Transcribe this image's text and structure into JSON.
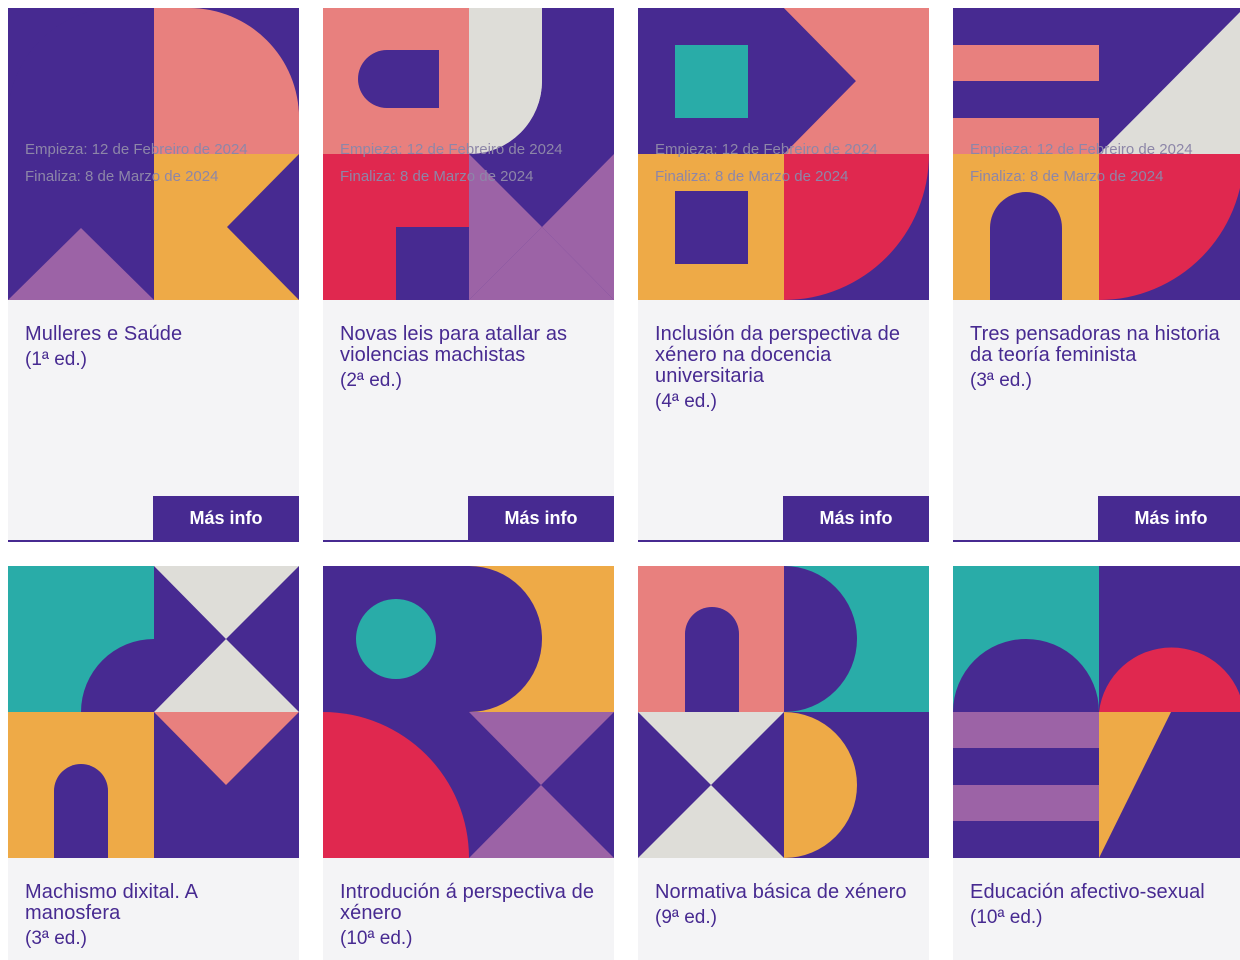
{
  "colors": {
    "purple": "#472a91",
    "pink": "#e8807e",
    "yellow": "#eeaa47",
    "red": "#e0284f",
    "lilac": "#9c63a6",
    "teal": "#29aca8",
    "cream": "#deddd8",
    "card_bg": "#f4f4f6"
  },
  "courses": [
    {
      "title": "Mulleres e Saúde",
      "edition": "(1ª ed.)",
      "start": "Empieza: 12 de Febreiro de 2024",
      "end": "Finaliza: 8 de Marzo de 2024",
      "button": "Más info"
    },
    {
      "title": "Novas leis para atallar as violencias machistas",
      "edition": "(2ª ed.)",
      "start": "Empieza: 12 de Febreiro de 2024",
      "end": "Finaliza: 8 de Marzo de 2024",
      "button": "Más info"
    },
    {
      "title": "Inclusión da perspectiva de xénero na docencia universitaria",
      "edition": "(4ª ed.)",
      "start": "Empieza: 12 de Febreiro de 2024",
      "end": "Finaliza: 8 de Marzo de 2024",
      "button": "Más info"
    },
    {
      "title": "Tres pensadoras na historia da teoría feminista",
      "edition": "(3ª ed.)",
      "start": "Empieza: 12 de Febreiro de 2024",
      "end": "Finaliza: 8 de Marzo de 2024",
      "button": "Más info"
    },
    {
      "title": "Machismo dixital. A manosfera",
      "edition": "(3ª ed.)"
    },
    {
      "title": "Introdución á perspectiva de xénero",
      "edition": "(10ª ed.)"
    },
    {
      "title": "Normativa básica de xénero",
      "edition": "(9ª ed.)"
    },
    {
      "title": "Educación afectivo-sexual",
      "edition": "(10ª ed.)"
    }
  ]
}
